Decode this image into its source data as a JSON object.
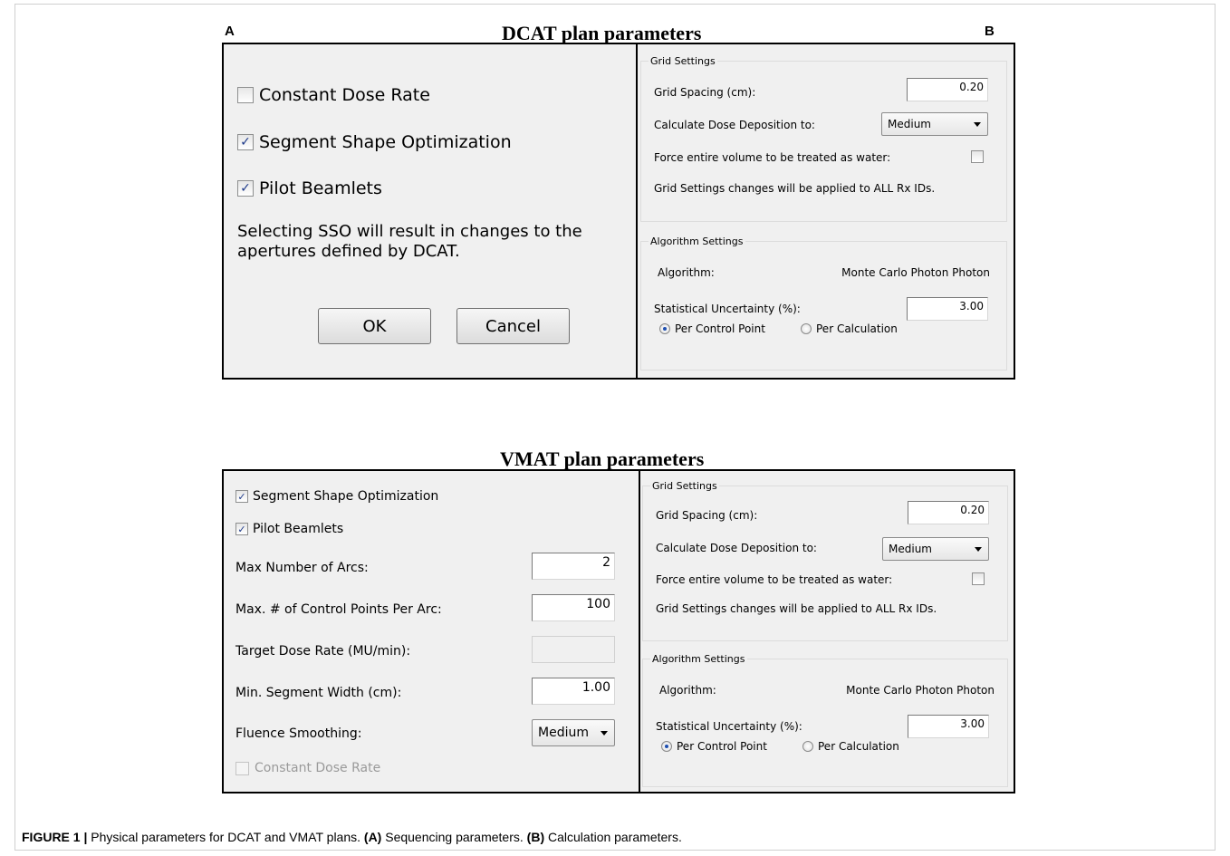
{
  "panel_letters": {
    "a": "A",
    "b": "B"
  },
  "dcat": {
    "title": "DCAT plan parameters",
    "left": {
      "options": [
        {
          "label": "Constant Dose Rate",
          "checked": false
        },
        {
          "label": "Segment Shape Optimization",
          "checked": true
        },
        {
          "label": "Pilot Beamlets",
          "checked": true
        }
      ],
      "note": "Selecting SSO will result in changes to the apertures defined by DCAT.",
      "ok_label": "OK",
      "cancel_label": "Cancel"
    }
  },
  "vmat": {
    "title": "VMAT plan parameters",
    "left": {
      "segment_shape_label": "Segment Shape Optimization",
      "segment_shape_checked": true,
      "pilot_beamlets_label": "Pilot Beamlets",
      "pilot_beamlets_checked": true,
      "max_arcs_label": "Max Number of Arcs:",
      "max_arcs_value": "2",
      "max_cp_label": "Max. # of Control Points Per Arc:",
      "max_cp_value": "100",
      "target_dose_label": "Target Dose Rate (MU/min):",
      "target_dose_value": "",
      "min_seg_label": "Min. Segment Width (cm):",
      "min_seg_value": "1.00",
      "fluence_label": "Fluence Smoothing:",
      "fluence_value": "Medium",
      "constant_dose_label": "Constant Dose Rate",
      "constant_dose_checked": false
    }
  },
  "calc": {
    "grid_group": "Grid Settings",
    "grid_spacing_label": "Grid Spacing (cm):",
    "grid_spacing_value": "0.20",
    "dose_deposition_label": "Calculate Dose Deposition to:",
    "dose_deposition_value": "Medium",
    "force_water_label": "Force entire volume to be treated as water:",
    "force_water_checked": false,
    "grid_note": "Grid Settings changes will be applied to ALL Rx IDs.",
    "algo_group": "Algorithm Settings",
    "algorithm_label": "Algorithm:",
    "algorithm_value": "Monte Carlo Photon Photon",
    "stat_unc_label": "Statistical Uncertainty (%):",
    "stat_unc_value": "3.00",
    "radio_per_cp": "Per Control Point",
    "radio_per_calc": "Per Calculation",
    "radio_selected": "Per Control Point"
  },
  "caption": {
    "figure_label": "FIGURE 1 |",
    "text": " Physical parameters for DCAT and VMAT plans. ",
    "a_label": "(A)",
    "a_text": " Sequencing parameters. ",
    "b_label": "(B)",
    "b_text": " Calculation parameters."
  }
}
